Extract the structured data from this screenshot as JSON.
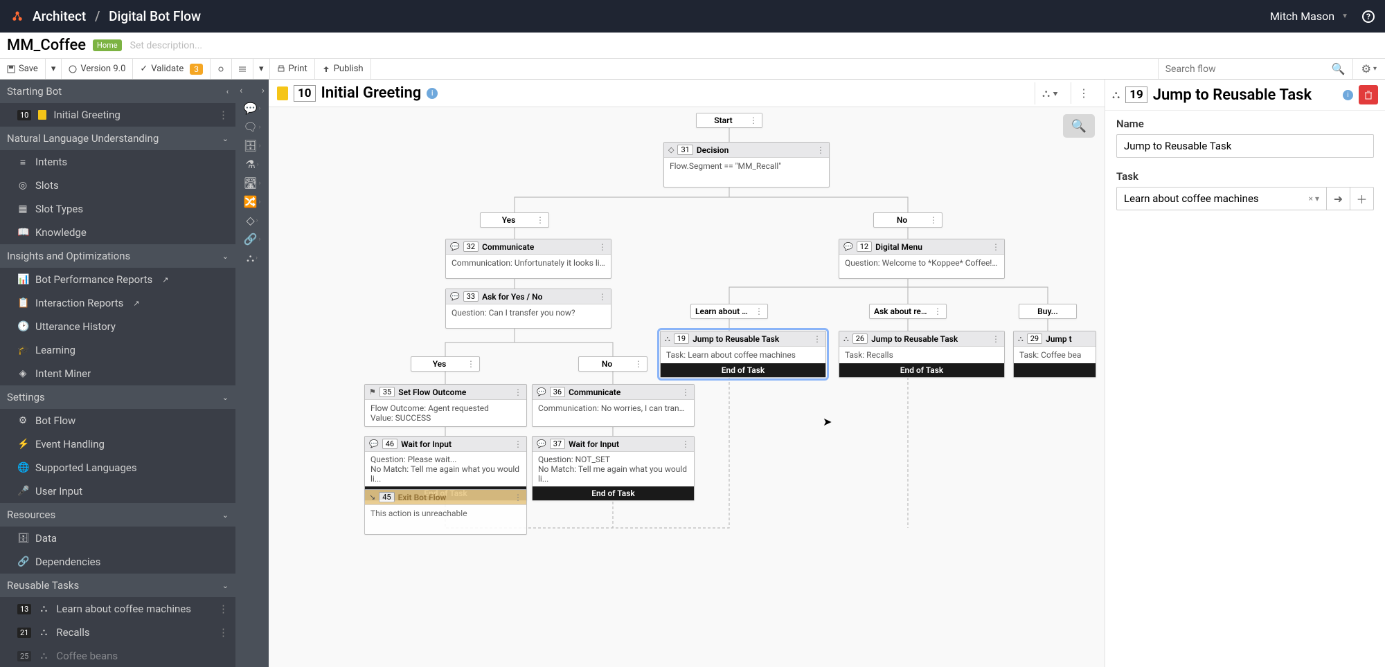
{
  "header": {
    "breadcrumb_root": "Architect",
    "breadcrumb_leaf": "Digital Bot Flow",
    "user": "Mitch Mason"
  },
  "title_row": {
    "flow_name": "MM_Coffee",
    "home_badge": "Home",
    "desc_placeholder": "Set description..."
  },
  "toolbar": {
    "save": "Save",
    "version": "Version 9.0",
    "validate": "Validate",
    "validate_count": "3",
    "print": "Print",
    "publish": "Publish",
    "search_placeholder": "Search flow"
  },
  "sidebar": {
    "sections": {
      "starting_bot": "Starting Bot",
      "nlu": "Natural Language Understanding",
      "insights": "Insights and Optimizations",
      "settings": "Settings",
      "resources": "Resources",
      "reusable": "Reusable Tasks"
    },
    "starting_bot_items": [
      {
        "num": "10",
        "label": "Initial Greeting"
      }
    ],
    "nlu_items": [
      {
        "label": "Intents"
      },
      {
        "label": "Slots"
      },
      {
        "label": "Slot Types"
      },
      {
        "label": "Knowledge"
      }
    ],
    "insights_items": [
      {
        "label": "Bot Performance Reports",
        "ext": true
      },
      {
        "label": "Interaction Reports",
        "ext": true
      },
      {
        "label": "Utterance History"
      },
      {
        "label": "Learning"
      },
      {
        "label": "Intent Miner"
      }
    ],
    "settings_items": [
      {
        "label": "Bot Flow"
      },
      {
        "label": "Event Handling"
      },
      {
        "label": "Supported Languages"
      },
      {
        "label": "User Input"
      }
    ],
    "resources_items": [
      {
        "label": "Data"
      },
      {
        "label": "Dependencies"
      }
    ],
    "reusable_items": [
      {
        "num": "13",
        "label": "Learn about coffee machines"
      },
      {
        "num": "21",
        "label": "Recalls"
      },
      {
        "num": "25",
        "label": "Coffee beans"
      }
    ]
  },
  "canvas": {
    "header_num": "10",
    "header_title": "Initial Greeting",
    "start": "Start",
    "nodes": {
      "decision": {
        "num": "31",
        "title": "Decision",
        "body": "Flow.Segment == \"MM_Recall\""
      },
      "yes1": "Yes",
      "no1": "No",
      "comm32": {
        "num": "32",
        "title": "Communicate",
        "body": "Communication: Unfortunately it looks like ..."
      },
      "menu12": {
        "num": "12",
        "title": "Digital Menu",
        "body": "Question: Welcome to *Koppee* Coffee! H..."
      },
      "ask33": {
        "num": "33",
        "title": "Ask for Yes / No",
        "body": "Question: Can I transfer you now?"
      },
      "learn_branch": "Learn about co...",
      "recall_branch": "Ask about reca...",
      "buy_branch": "Buy...",
      "jump19": {
        "num": "19",
        "title": "Jump to Reusable Task",
        "body": "Task: Learn about coffee machines"
      },
      "jump26": {
        "num": "26",
        "title": "Jump to Reusable Task",
        "body": "Task: Recalls"
      },
      "jump29": {
        "num": "29",
        "title": "Jump t",
        "body": "Task: Coffee bea"
      },
      "end_of_task": "End of Task",
      "yes2": "Yes",
      "no2": "No",
      "set35": {
        "num": "35",
        "title": "Set Flow Outcome",
        "body1": "Flow Outcome: Agent requested",
        "body2": "Value: SUCCESS"
      },
      "comm36": {
        "num": "36",
        "title": "Communicate",
        "body": "Communication: No worries, I can transfer ..."
      },
      "wait46": {
        "num": "46",
        "title": "Wait for Input",
        "body1": "Question: Please wait...",
        "body2": "No Match: Tell me again what you would li..."
      },
      "wait37": {
        "num": "37",
        "title": "Wait for Input",
        "body1": "Question: NOT_SET",
        "body2": "No Match: Tell me again what you would li..."
      },
      "exit45": {
        "num": "45",
        "title": "Exit Bot Flow",
        "body": "This action is unreachable"
      }
    }
  },
  "right_panel": {
    "header_num": "19",
    "header_title": "Jump to Reusable Task",
    "name_label": "Name",
    "name_value": "Jump to Reusable Task",
    "task_label": "Task",
    "task_value": "Learn about coffee machines"
  }
}
